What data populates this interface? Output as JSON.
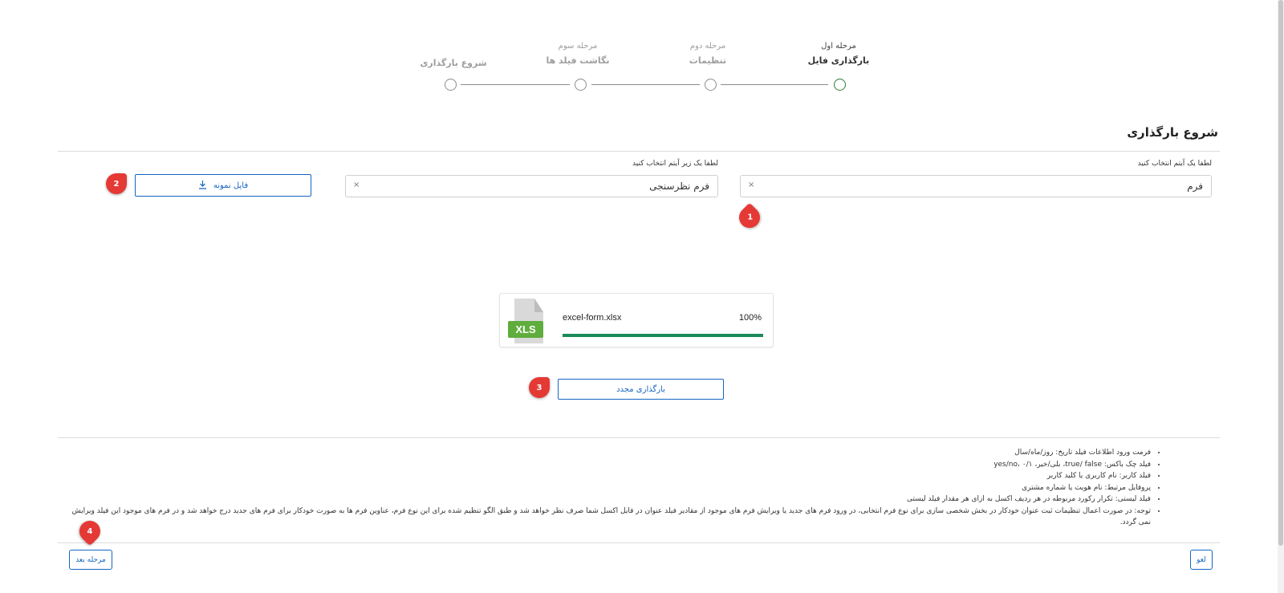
{
  "stepper": {
    "steps": [
      {
        "sub": "مرحله اول",
        "main": "بارگذاری فایل"
      },
      {
        "sub": "مرحله دوم",
        "main": "تنظیمات"
      },
      {
        "sub": "مرحله سوم",
        "main": "نگاشت فیلد ها"
      },
      {
        "sub": "",
        "main": "شروع بارگذاری"
      }
    ],
    "active_index": 0
  },
  "section": {
    "title": "شروع بارگذاری"
  },
  "form": {
    "item_label": "لطفا یک آیتم انتخاب کنید",
    "item_value": "فرم",
    "subitem_label": "لطفا یک زیر آیتم انتخاب کنید",
    "subitem_value": "فرم نظرسنجی",
    "clear_glyph": "×",
    "sample_button": "فایل نمونه"
  },
  "upload": {
    "file_name": "excel-form.xlsx",
    "percent_label": "100%",
    "progress": 1.0,
    "icon_label": "XLS",
    "reupload_button": "بارگذاری مجدد"
  },
  "badges": [
    "1",
    "2",
    "3",
    "4"
  ],
  "notes": [
    "فرمت ورود اطلاعات فیلد تاریخ: روز/ماه/سال",
    "فیلد چک باکس: true/ false، بلی/خیر، ۰/۱ ،yes/no",
    "فیلد کاربر: نام کاربری یا کلید کاربر",
    "پروفایل مرتبط: نام هویت یا شماره مشتری",
    "فیلد لیستی: تکرار رکورد مربوطه در هر ردیف اکسل به ازای هر مقدار فیلد لیستی",
    "توجه: در صورت اعمال تنظیمات ثبت عنوان خودکار در بخش شخصی سازی برای نوع فرم انتخابی، در ورود فرم های جدید یا ویرایش فرم های موجود از مقادیر فیلد عنوان در فایل اکسل شما صرف نظر خواهد شد و طبق الگو تنظیم شده برای این نوع فرم، عناوین فرم ها به صورت خودکار برای فرم های جدید درج خواهد شد و در فرم های موجود این فیلد ویرایش نمی گردد."
  ],
  "footer": {
    "cancel": "لغو",
    "next": "مرحله بعد"
  },
  "colors": {
    "accent": "#1565c0",
    "badge": "#e53935",
    "progress": "#1b8a5a",
    "xls": "#5fad3d",
    "active_step": "#2e7d32"
  }
}
